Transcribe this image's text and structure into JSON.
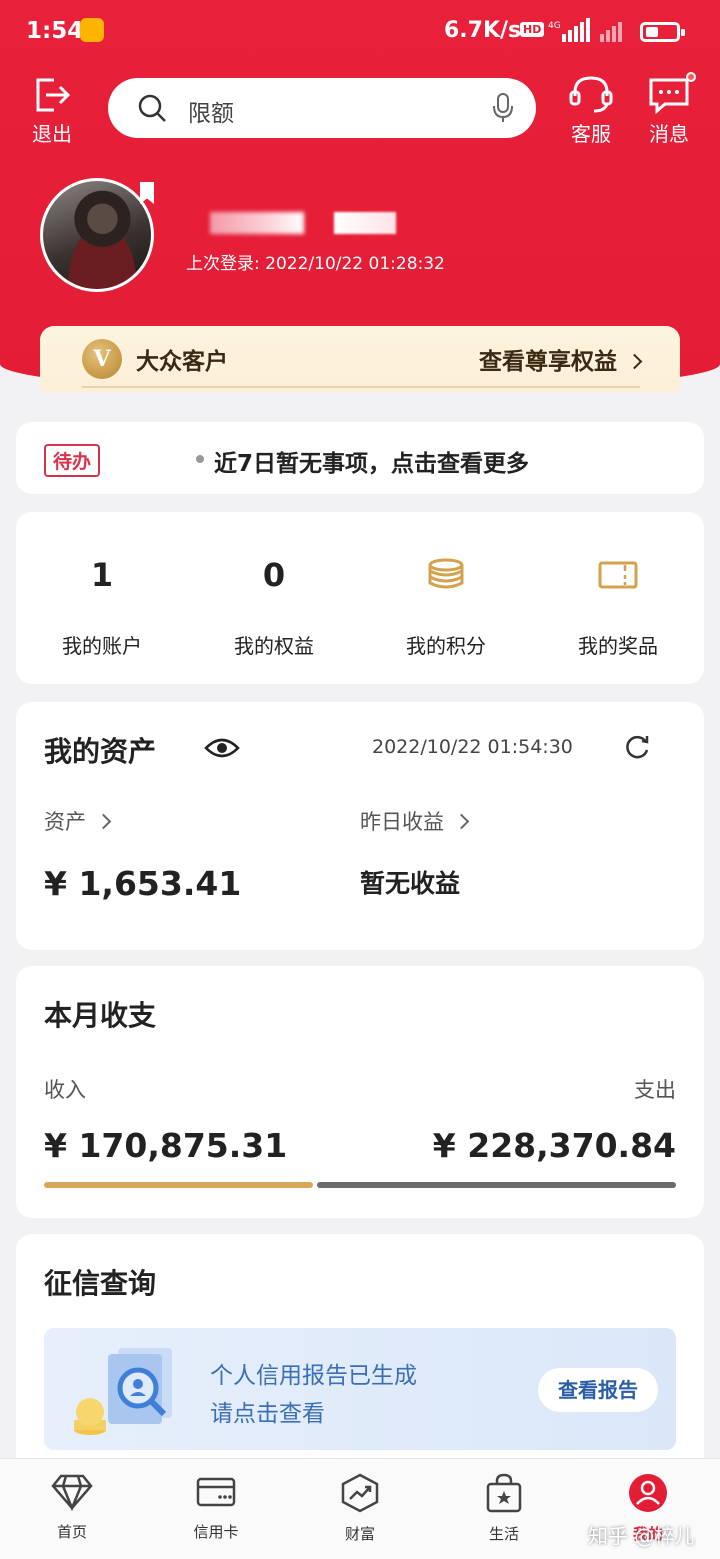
{
  "status_bar": {
    "time": "1:54",
    "speed": "6.7K/s",
    "hd": "HD",
    "network": "4G"
  },
  "header": {
    "exit_label": "退出",
    "search_placeholder": "限额",
    "service_label": "客服",
    "message_label": "消息"
  },
  "profile": {
    "last_login": "上次登录: 2022/10/22 01:28:32"
  },
  "vip": {
    "badge_letter": "V",
    "level": "大众客户",
    "link": "查看尊享权益"
  },
  "todo": {
    "tag": "待办",
    "text": "近7日暂无事项，点击查看更多"
  },
  "quick": [
    {
      "value": "1",
      "label": "我的账户"
    },
    {
      "value": "0",
      "label": "我的权益"
    },
    {
      "icon": "coins-icon",
      "label": "我的积分"
    },
    {
      "icon": "ticket-icon",
      "label": "我的奖品"
    }
  ],
  "assets": {
    "title": "我的资产",
    "timestamp": "2022/10/22 01:54:30",
    "assets_label": "资产",
    "assets_value": "¥ 1,653.41",
    "yield_label": "昨日收益",
    "yield_value": "暂无收益"
  },
  "monthly": {
    "title": "本月收支",
    "income_label": "收入",
    "income_value": "¥ 170,875.31",
    "expense_label": "支出",
    "expense_value": "¥ 228,370.84",
    "income_share": 0.428
  },
  "credit": {
    "title": "征信查询",
    "line1": "个人信用报告已生成",
    "line2": "请点击查看",
    "button": "查看报告"
  },
  "tabs": [
    {
      "label": "首页",
      "icon": "diamond-icon"
    },
    {
      "label": "信用卡",
      "icon": "card-icon"
    },
    {
      "label": "财富",
      "icon": "chart-icon"
    },
    {
      "label": "生活",
      "icon": "bag-icon"
    },
    {
      "label": "我的",
      "icon": "user-icon",
      "active": true
    }
  ],
  "watermark": "知乎 @椊儿",
  "colors": {
    "brand_red": "#e41d36",
    "gold": "#d9a75a",
    "expense_gray": "#6a6a6a"
  }
}
